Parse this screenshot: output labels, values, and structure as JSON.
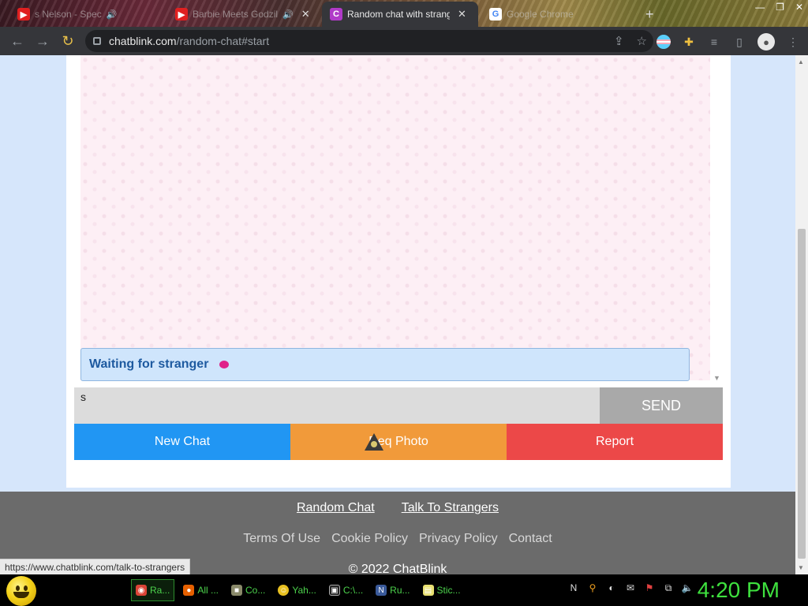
{
  "browser": {
    "tabs": [
      {
        "title": "s Nelson - Spec",
        "favicon": "youtube-icon",
        "audio": "speaker-icon"
      },
      {
        "title": "Barbie Meets Godzil",
        "favicon": "youtube-icon",
        "audio": "speaker-icon"
      },
      {
        "title": "Random chat with strang",
        "favicon": "chatblink-icon",
        "favicon_letter": "C"
      },
      {
        "title": "Google Chrome",
        "favicon": "google-icon"
      }
    ],
    "new_tab": "+",
    "url_host": "chatblink.com",
    "url_path": "/random-chat#start"
  },
  "chat": {
    "status": "Waiting for stranger",
    "input_value": "s",
    "send_label": "SEND",
    "buttons": {
      "new_chat": "New Chat",
      "photo": "Req Photo",
      "report": "Report"
    }
  },
  "footer": {
    "primary_links": [
      "Random Chat",
      "Talk To Strangers"
    ],
    "secondary_links": [
      "Terms Of Use",
      "Cookie Policy",
      "Privacy Policy",
      "Contact"
    ],
    "copyright": "© 2022 ChatBlink"
  },
  "status_url": "https://www.chatblink.com/talk-to-strangers",
  "taskbar": {
    "tasks": [
      {
        "label": "Ra...",
        "icon": "chrome-icon"
      },
      {
        "label": "All ...",
        "icon": "firefox-icon"
      },
      {
        "label": "Co...",
        "icon": "control-icon"
      },
      {
        "label": "Yah...",
        "icon": "yahoo-messenger-icon"
      },
      {
        "label": "C:\\...",
        "icon": "command-prompt-icon"
      },
      {
        "label": "Ru...",
        "icon": "run-icon"
      },
      {
        "label": "Stic...",
        "icon": "sticky-notes-icon"
      }
    ],
    "clock": "4:20 PM"
  },
  "colors": {
    "new_chat": "#2196f3",
    "photo": "#f19a3a",
    "report": "#ec4848",
    "send": "#a9a9a9",
    "status_text": "#1e5aa0",
    "status_dot": "#e0228a",
    "clock": "#3ee03e"
  }
}
